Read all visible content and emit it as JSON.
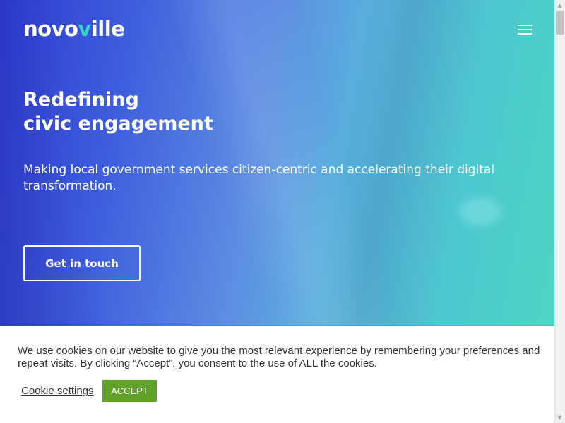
{
  "header": {
    "logo_prefix": "novo",
    "logo_accent": "v",
    "logo_suffix": "ille",
    "menu_icon": "hamburger-menu-icon"
  },
  "hero": {
    "headline_line1": "Redefining",
    "headline_line2": "civic engagement",
    "subtitle": "Making local government services citizen-centric and accelerating their digital transformation.",
    "cta_label": "Get in touch"
  },
  "cookie_banner": {
    "message": "We use cookies on our website to give you the most relevant experience by remembering your preferences and repeat visits. By clicking “Accept”, you consent to the use of ALL the cookies.",
    "settings_label": "Cookie settings",
    "accept_label": "ACCEPT"
  },
  "scrollbar": {
    "up_icon": "▲",
    "down_icon": "▼"
  },
  "colors": {
    "gradient_start": "#2d3bd0",
    "gradient_end": "#4fd6c2",
    "logo_accent": "#33d6c2",
    "accept_button": "#61a229"
  }
}
